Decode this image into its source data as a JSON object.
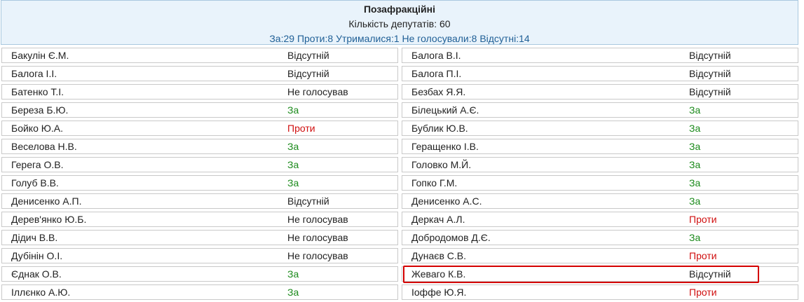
{
  "header": {
    "title": "Позафракційні",
    "count_text": "Кількість депутатів: 60",
    "summary_text": "За:29 Проти:8 Утрималися:1 Не голосували:8 Відсутні:14"
  },
  "colors": {
    "za": "#1b8a1b",
    "proty": "#d01010",
    "header_bg": "#e9f3fb",
    "summary": "#1f5f96",
    "highlight": "#d40000"
  },
  "left_column": [
    {
      "name": "Бакулін Є.М.",
      "vote": "Відсутній",
      "type": "absent"
    },
    {
      "name": "Балога І.І.",
      "vote": "Відсутній",
      "type": "absent"
    },
    {
      "name": "Батенко Т.І.",
      "vote": "Не голосував",
      "type": "novote"
    },
    {
      "name": "Береза Б.Ю.",
      "vote": "За",
      "type": "za"
    },
    {
      "name": "Бойко Ю.А.",
      "vote": "Проти",
      "type": "proty"
    },
    {
      "name": "Веселова Н.В.",
      "vote": "За",
      "type": "za"
    },
    {
      "name": "Герега О.В.",
      "vote": "За",
      "type": "za"
    },
    {
      "name": "Голуб В.В.",
      "vote": "За",
      "type": "za"
    },
    {
      "name": "Денисенко А.П.",
      "vote": "Відсутній",
      "type": "absent"
    },
    {
      "name": "Дерев'янко Ю.Б.",
      "vote": "Не голосував",
      "type": "novote"
    },
    {
      "name": "Дідич В.В.",
      "vote": "Не голосував",
      "type": "novote"
    },
    {
      "name": "Дубінін О.І.",
      "vote": "Не голосував",
      "type": "novote"
    },
    {
      "name": "Єднак О.В.",
      "vote": "За",
      "type": "za"
    },
    {
      "name": "Іллєнко А.Ю.",
      "vote": "За",
      "type": "za"
    }
  ],
  "right_column": [
    {
      "name": "Балога В.І.",
      "vote": "Відсутній",
      "type": "absent"
    },
    {
      "name": "Балога П.І.",
      "vote": "Відсутній",
      "type": "absent"
    },
    {
      "name": "Безбах Я.Я.",
      "vote": "Відсутній",
      "type": "absent"
    },
    {
      "name": "Білецький А.Є.",
      "vote": "За",
      "type": "za"
    },
    {
      "name": "Бублик Ю.В.",
      "vote": "За",
      "type": "za"
    },
    {
      "name": "Геращенко І.В.",
      "vote": "За",
      "type": "za"
    },
    {
      "name": "Головко М.Й.",
      "vote": "За",
      "type": "za"
    },
    {
      "name": "Гопко Г.М.",
      "vote": "За",
      "type": "za"
    },
    {
      "name": "Денисенко А.С.",
      "vote": "За",
      "type": "za"
    },
    {
      "name": "Деркач А.Л.",
      "vote": "Проти",
      "type": "proty"
    },
    {
      "name": "Добродомов Д.Є.",
      "vote": "За",
      "type": "za"
    },
    {
      "name": "Дунаєв С.В.",
      "vote": "Проти",
      "type": "proty"
    },
    {
      "name": "Жеваго К.В.",
      "vote": "Відсутній",
      "type": "absent"
    },
    {
      "name": "Іоффе Ю.Я.",
      "vote": "Проти",
      "type": "proty"
    }
  ]
}
